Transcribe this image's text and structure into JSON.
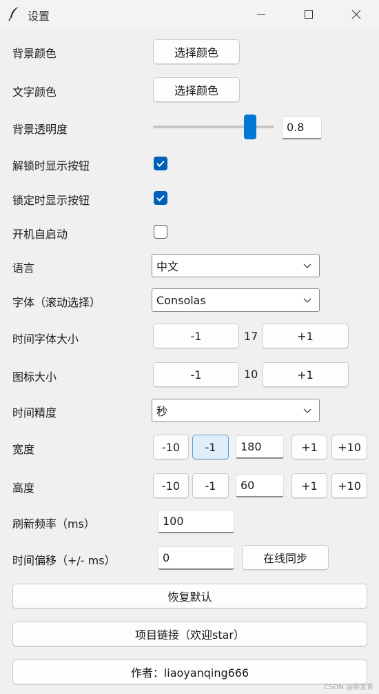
{
  "window": {
    "title": "设置",
    "controls": [
      "minimize",
      "maximize",
      "close"
    ]
  },
  "settings": {
    "bg_color": {
      "label": "背景颜色",
      "button": "选择颜色"
    },
    "text_color": {
      "label": "文字颜色",
      "button": "选择颜色"
    },
    "bg_opacity": {
      "label": "背景透明度",
      "value": "0.8",
      "slider_fraction": 0.8
    },
    "show_btn_unlocked": {
      "label": "解锁时显示按钮",
      "checked": true
    },
    "show_btn_locked": {
      "label": "锁定时显示按钮",
      "checked": true
    },
    "autostart": {
      "label": "开机自启动",
      "checked": false
    },
    "language": {
      "label": "语言",
      "selected": "中文"
    },
    "font": {
      "label": "字体（滚动选择）",
      "selected": "Consolas"
    },
    "time_font_size": {
      "label": "时间字体大小",
      "dec": "-1",
      "value": "17",
      "inc": "+1"
    },
    "icon_size": {
      "label": "图标大小",
      "dec": "-1",
      "value": "10",
      "inc": "+1"
    },
    "time_precision": {
      "label": "时间精度",
      "selected": "秒"
    },
    "width": {
      "label": "宽度",
      "dec10": "-10",
      "dec1": "-1",
      "value": "180",
      "inc1": "+1",
      "inc10": "+10"
    },
    "height": {
      "label": "高度",
      "dec10": "-10",
      "dec1": "-1",
      "value": "60",
      "inc1": "+1",
      "inc10": "+10"
    },
    "refresh_rate": {
      "label": "刷新频率（ms）",
      "value": "100"
    },
    "time_offset": {
      "label": "时间偏移（+/- ms）",
      "value": "0",
      "sync_button": "在线同步"
    }
  },
  "actions": {
    "restore_defaults": "恢复默认",
    "project_link": "项目链接（欢迎star）",
    "author": "作者：liaoyanqing666"
  },
  "watermark": "CSDN @柳言青",
  "colors": {
    "accent": "#0078d4",
    "checkbox": "#005fb8",
    "window_bg": "#f0f0f0"
  }
}
